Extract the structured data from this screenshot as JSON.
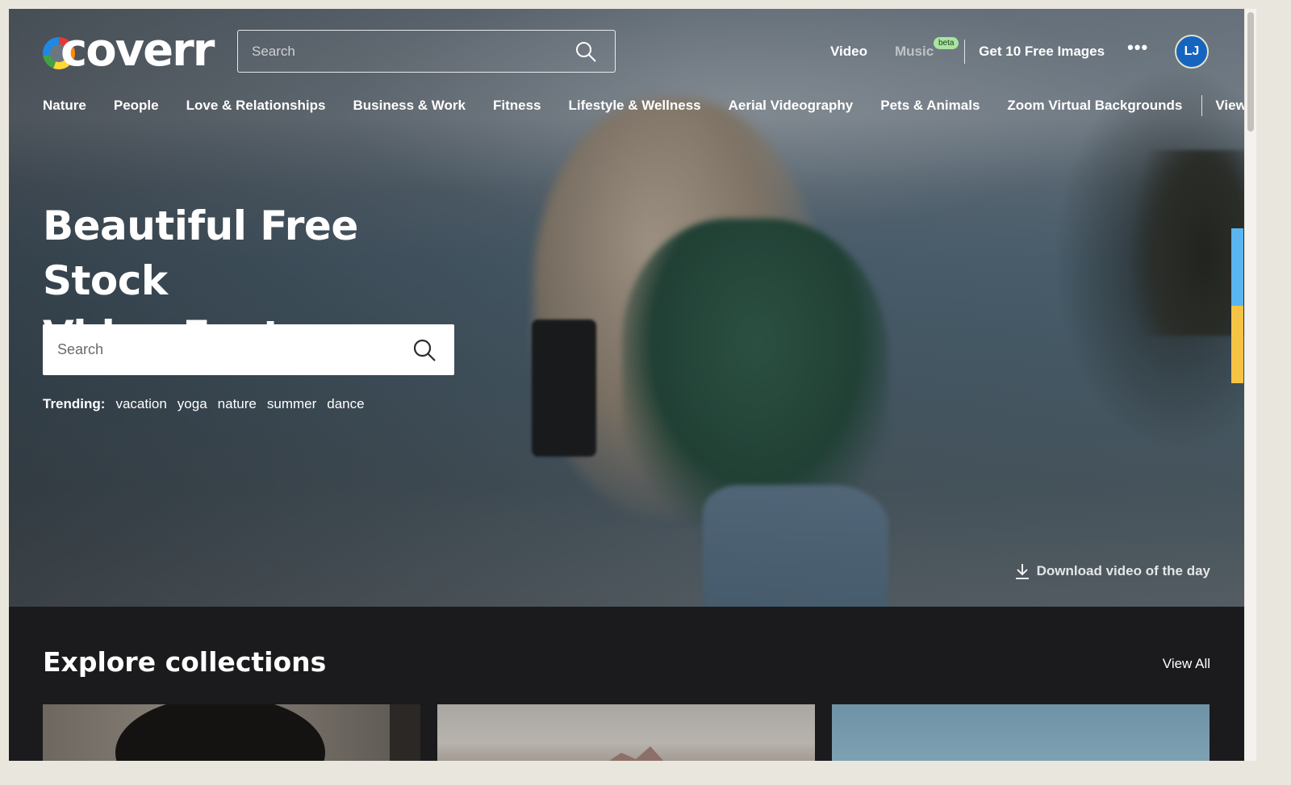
{
  "header": {
    "logo_text": "coverr",
    "search_placeholder": "Search",
    "nav": {
      "video": "Video",
      "music": "Music",
      "music_badge": "beta",
      "free_images": "Get 10 Free Images",
      "more": "•••"
    },
    "avatar_initials": "LJ"
  },
  "categories": [
    "Nature",
    "People",
    "Love & Relationships",
    "Business & Work",
    "Fitness",
    "Lifestyle & Wellness",
    "Aerial Videography",
    "Pets & Animals",
    "Zoom Virtual Backgrounds"
  ],
  "categories_view_all": "View all",
  "hero": {
    "title_line1": "Beautiful Free Stock",
    "title_line2": "Video Footage",
    "search_placeholder": "Search",
    "trending_label": "Trending:",
    "trending_tags": [
      "vacation",
      "yoga",
      "nature",
      "summer",
      "dance"
    ],
    "download_label": "Download video of the day"
  },
  "collections": {
    "title": "Explore collections",
    "view_all": "View All"
  },
  "colors": {
    "side_tab_blue": "#5ab5f0",
    "side_tab_yellow": "#f6c445",
    "avatar_bg": "#1565c0",
    "beta_badge_bg": "#a9e5a0",
    "collections_bg": "#1b1b1d"
  },
  "icons": [
    "search-icon",
    "download-icon",
    "more-dots-icon"
  ]
}
